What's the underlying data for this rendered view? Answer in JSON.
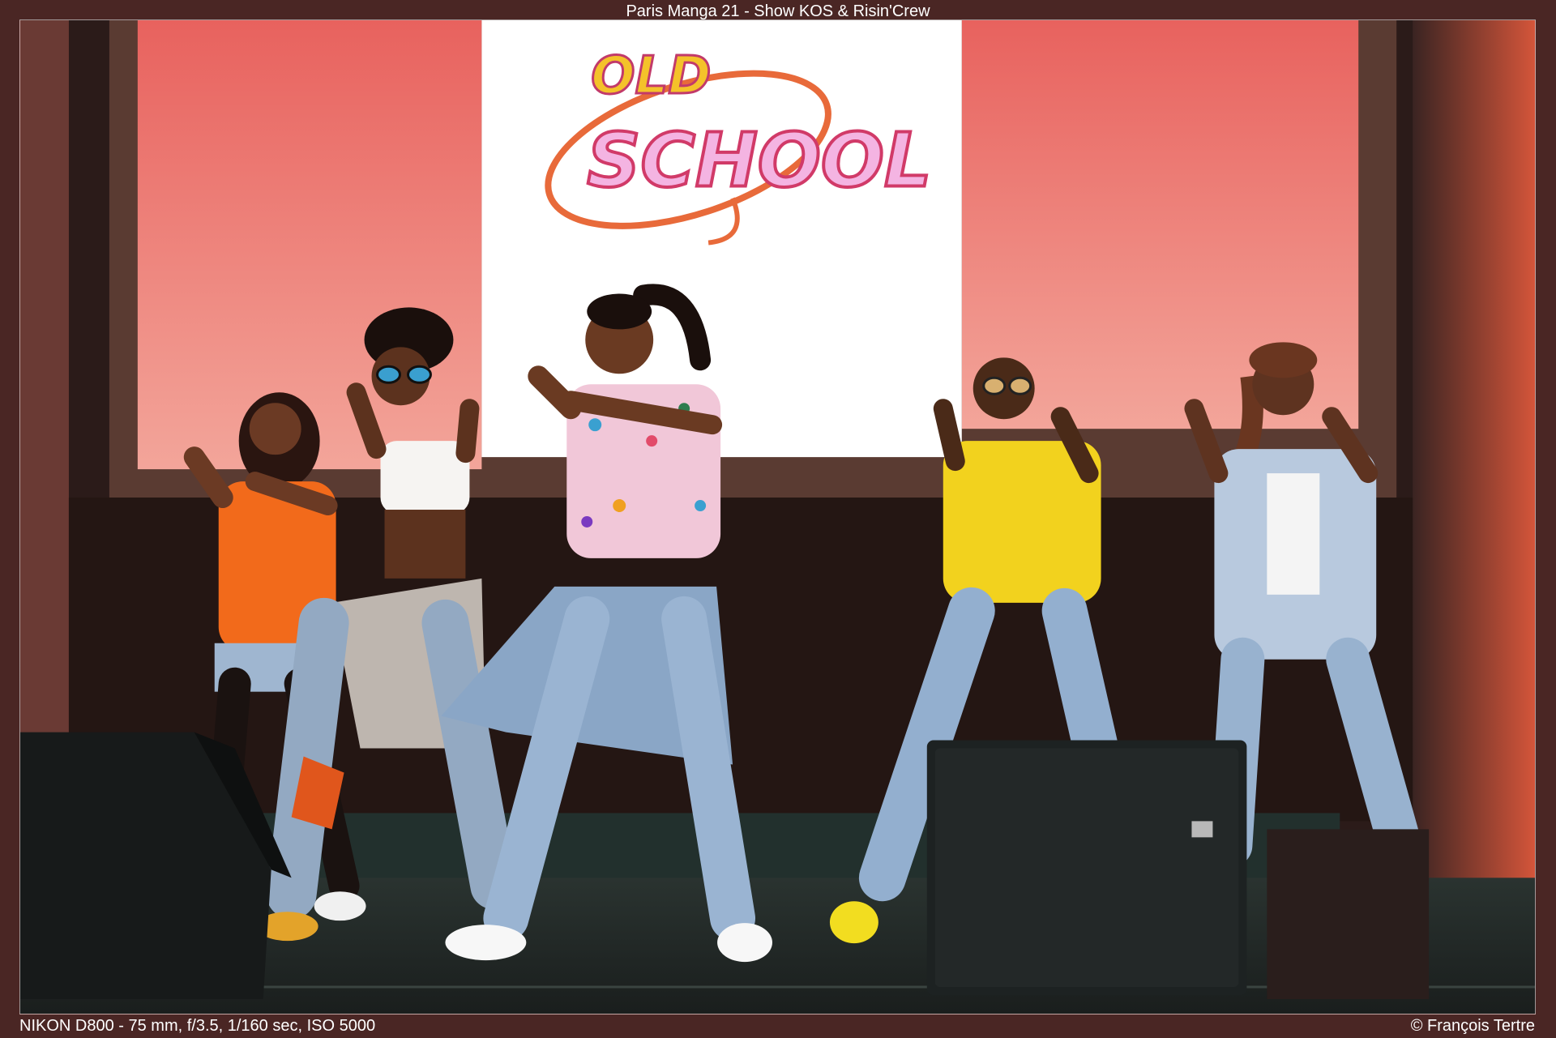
{
  "photo": {
    "subject": "Five dancers performing on stage in front of a projection screen",
    "screen_logo": {
      "line1": "OLD",
      "line2": "SCHOOL"
    },
    "colors": {
      "screen_side": "#f07a72",
      "screen_center": "#ffffff",
      "stage_wall": "#2b1b19",
      "floor": "#2c2a28",
      "shirt_orange": "#f26a1b",
      "shirt_yellow": "#f2d21e",
      "jeans": "#8faac8"
    }
  },
  "captions": {
    "title": "Paris Manga 21 - Show KOS & Risin'Crew",
    "camera": "NIKON D800 - 75 mm, f/3.5, 1/160 sec, ISO 5000",
    "credit": "© François Tertre"
  }
}
